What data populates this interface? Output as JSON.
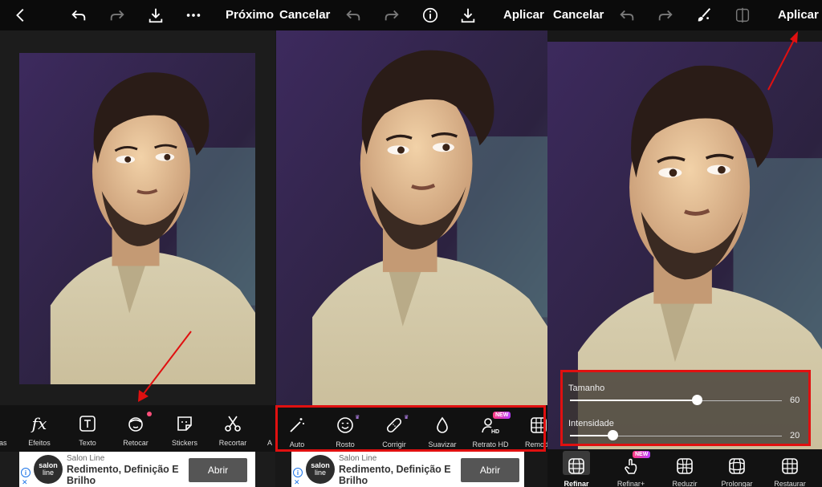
{
  "panel1": {
    "topbar": {
      "next_label": "Próximo"
    },
    "tools": [
      {
        "label": "ntas",
        "icon": "paint-icon"
      },
      {
        "label": "Efeitos",
        "icon": "fx-icon"
      },
      {
        "label": "Texto",
        "icon": "text-icon"
      },
      {
        "label": "Retocar",
        "icon": "retouch-face-icon"
      },
      {
        "label": "Stickers",
        "icon": "sticker-icon"
      },
      {
        "label": "Recortar",
        "icon": "scissors-icon"
      },
      {
        "label": "A",
        "icon": "more-icon"
      }
    ]
  },
  "panel2": {
    "topbar": {
      "cancel_label": "Cancelar",
      "apply_label": "Aplicar"
    },
    "tools": [
      {
        "label": "Auto",
        "icon": "magic-wand-icon"
      },
      {
        "label": "Rosto",
        "icon": "face-icon"
      },
      {
        "label": "Corrigir",
        "icon": "bandage-icon"
      },
      {
        "label": "Suavizar",
        "icon": "drop-icon"
      },
      {
        "label": "Retrato HD",
        "icon": "portrait-hd-icon"
      },
      {
        "label": "Remode",
        "icon": "grid-icon"
      }
    ],
    "new_badge": "NEW"
  },
  "panel3": {
    "topbar": {
      "cancel_label": "Cancelar",
      "apply_label": "Aplicar"
    },
    "sliders": [
      {
        "label": "Tamanho",
        "value": "60",
        "fraction": 0.6
      },
      {
        "label": "Intensidade",
        "value": "20",
        "fraction": 0.2
      }
    ],
    "tools": [
      {
        "label": "Refinar",
        "icon": "refine-grid-icon"
      },
      {
        "label": "Refinar+",
        "icon": "hand-touch-icon"
      },
      {
        "label": "Reduzir",
        "icon": "reduce-grid-icon"
      },
      {
        "label": "Prolongar",
        "icon": "extend-grid-icon"
      },
      {
        "label": "Restaurar",
        "icon": "restore-grid-icon"
      }
    ],
    "new_badge": "NEW"
  },
  "ad": {
    "logo_line1": "salon",
    "logo_line2": "line",
    "brand": "Salon Line",
    "headline": "Redimento, Definição E Brilho",
    "button": "Abrir"
  },
  "colors": {
    "accent_red": "#e01010",
    "new_badge": "#ff3d7f"
  }
}
